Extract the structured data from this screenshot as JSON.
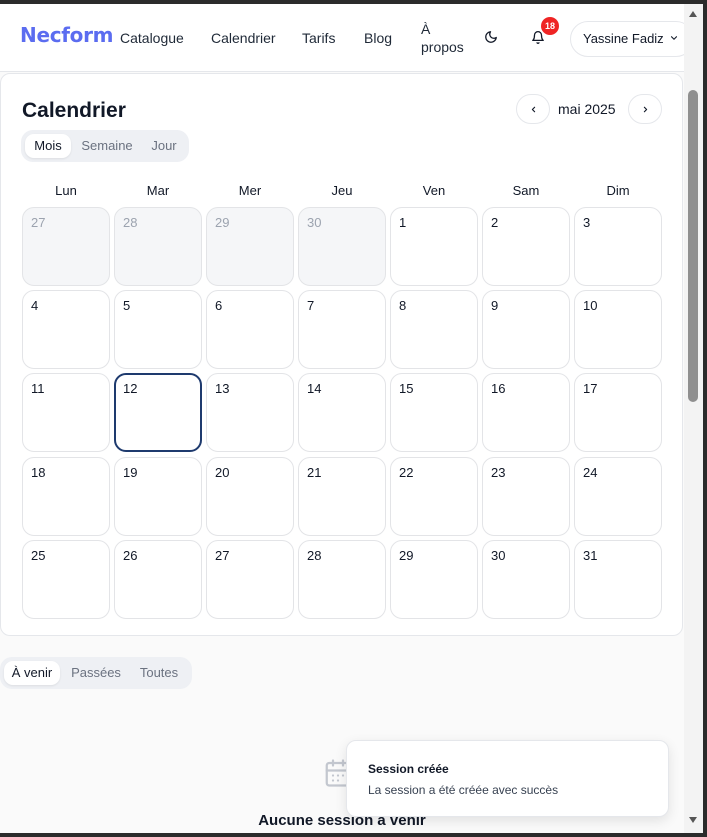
{
  "header": {
    "logo": "Necform",
    "nav": [
      "Catalogue",
      "Calendrier",
      "Tarifs",
      "Blog"
    ],
    "about_line1": "À",
    "about_line2": "propos",
    "notification_count": "18",
    "user_name": "Yassine Fadiz",
    "icons": [
      "moon-icon",
      "bell-icon",
      "chevron-down-icon"
    ]
  },
  "calendar": {
    "title": "Calendrier",
    "month_label": "mai 2025",
    "views": [
      "Mois",
      "Semaine",
      "Jour"
    ],
    "active_view": "Mois",
    "weekdays": [
      "Lun",
      "Mar",
      "Mer",
      "Jeu",
      "Ven",
      "Sam",
      "Dim"
    ],
    "weeks": [
      [
        "27",
        "28",
        "29",
        "30",
        "1",
        "2",
        "3"
      ],
      [
        "4",
        "5",
        "6",
        "7",
        "8",
        "9",
        "10"
      ],
      [
        "11",
        "12",
        "13",
        "14",
        "15",
        "16",
        "17"
      ],
      [
        "18",
        "19",
        "20",
        "21",
        "22",
        "23",
        "24"
      ],
      [
        "25",
        "26",
        "27",
        "28",
        "29",
        "30",
        "31"
      ]
    ],
    "other_month_days_in_first_week": 4,
    "today": "12"
  },
  "sessions": {
    "filters": [
      "À venir",
      "Passées",
      "Toutes"
    ],
    "active_filter": "À venir",
    "empty_text": "Aucune session à venir"
  },
  "toast": {
    "title": "Session créée",
    "description": "La session a été créée avec succès"
  },
  "colors": {
    "brand": "#5b6cf0",
    "today_border": "#1e3a6e",
    "badge": "#ef2424"
  }
}
